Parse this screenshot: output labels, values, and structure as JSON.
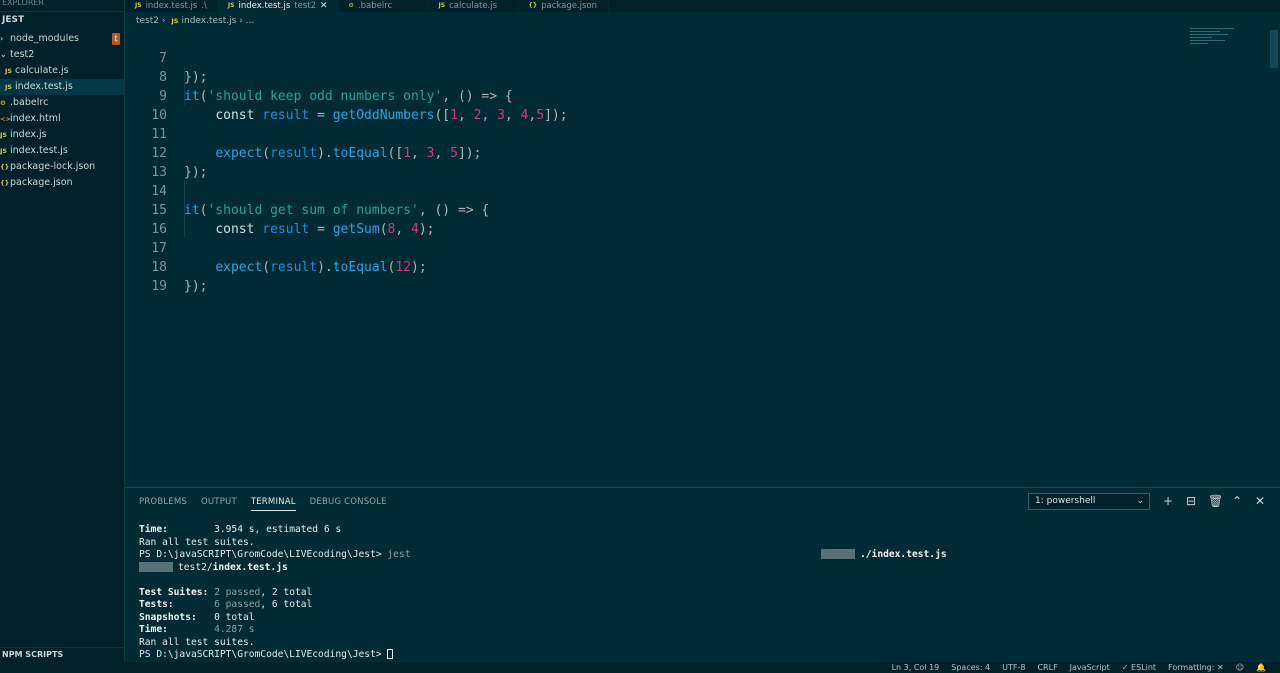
{
  "sidebar": {
    "title": "EXPLORER",
    "section": "JEST",
    "items": [
      {
        "icon": "›",
        "label": "node_modules",
        "badge": "t"
      },
      {
        "icon": "⌄",
        "label": "test2"
      },
      {
        "icon": "JS",
        "label": "calculate.js"
      },
      {
        "icon": "JS",
        "label": "index.test.js"
      },
      {
        "icon": "⚙",
        "label": ".babelrc"
      },
      {
        "icon": "<>",
        "label": "index.html"
      },
      {
        "icon": "JS",
        "label": "index.js"
      },
      {
        "icon": "JS",
        "label": "index.test.js"
      },
      {
        "icon": "{}",
        "label": "package-lock.json"
      },
      {
        "icon": "{}",
        "label": "package.json"
      }
    ],
    "footer": "NPM SCRIPTS"
  },
  "tabs": [
    {
      "icon": "JS",
      "label": "index.test.js",
      "hint": ".\\"
    },
    {
      "icon": "JS",
      "label": "index.test.js",
      "hint": "test2",
      "close": "✕"
    },
    {
      "icon": "⚙",
      "label": ".babelrc"
    },
    {
      "icon": "JS",
      "label": "calculate.js"
    },
    {
      "icon": "{}",
      "label": "package.json"
    }
  ],
  "breadcrumb": {
    "folder": "test2",
    "sep1": "›",
    "icon": "JS",
    "file": "index.test.js",
    "sep2": "›",
    "tail": "..."
  },
  "editor": {
    "line_numbers": [
      "7",
      "8",
      "9",
      "10",
      "11",
      "12",
      "13",
      "14",
      "15",
      "16",
      "17",
      "18",
      "19"
    ]
  },
  "panel": {
    "tabs": [
      "PROBLEMS",
      "OUTPUT",
      "TERMINAL",
      "DEBUG CONSOLE"
    ],
    "terminal_select": "1: powershell",
    "icons": {
      "add": "+",
      "split": "⊟",
      "trash": "🗑",
      "maximize": "⌃",
      "close": "✕"
    },
    "terminal": {
      "time1_label": "Time:",
      "time1_value": "3.954 s, estimated 6 s",
      "ran1": "Ran all test suites.",
      "prompt1": "PS D:\\javaSCRIPT\\GromCode\\LIVEcoding\\Jest>",
      "cmd1": " jest",
      "pass1_path": "./index.test.js",
      "pass2_dir": "test2/",
      "pass2_file": "index.test.js",
      "suites_label": "Test Suites:",
      "suites_passed": "2 passed",
      "suites_total": ", 2 total",
      "tests_label": "Tests:",
      "tests_passed": "6 passed",
      "tests_total": ", 6 total",
      "snap_label": "Snapshots:",
      "snap_value": "0 total",
      "time2_label": "Time:",
      "time2_value": "4.287 s",
      "ran2": "Ran all test suites.",
      "prompt2": "PS D:\\javaSCRIPT\\GromCode\\LIVEcoding\\Jest>"
    }
  },
  "status": {
    "position": "Ln 3, Col 19",
    "spaces": "Spaces: 4",
    "encoding": "UTF-8",
    "eol": "CRLF",
    "language": "JavaScript",
    "eslint": "✓ ESLint",
    "formatting": "Formatting: ✕",
    "feedback_icon": "☺",
    "bell_icon": "🔔"
  }
}
